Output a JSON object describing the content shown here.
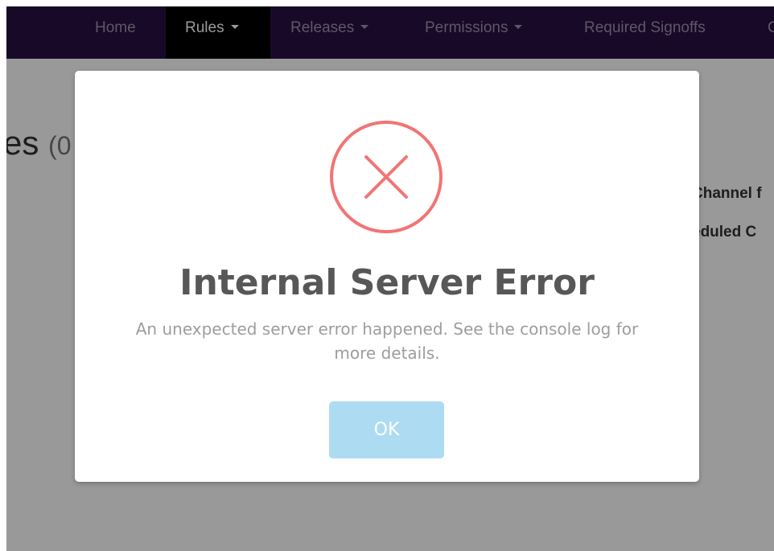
{
  "navbar": {
    "items": [
      {
        "label": "Home",
        "has_caret": false,
        "active": false
      },
      {
        "label": "Rules",
        "has_caret": true,
        "active": true
      },
      {
        "label": "Releases",
        "has_caret": true,
        "active": false
      },
      {
        "label": "Permissions",
        "has_caret": true,
        "active": false
      },
      {
        "label": "Required Signoffs",
        "has_caret": false,
        "active": false
      },
      {
        "label": "C",
        "has_caret": false,
        "active": false
      }
    ]
  },
  "page": {
    "heading_partial": "es",
    "count_partial": "(0",
    "side_labels": [
      "Channel f",
      "eduled C"
    ]
  },
  "modal": {
    "icon": "error-x-circle-icon",
    "title": "Internal Server Error",
    "text": "An unexpected server error happened. See the console log for more details.",
    "ok_label": "OK"
  },
  "colors": {
    "navbar_bg": "#2a0f43",
    "error_red": "#f27474",
    "ok_button_bg": "#addcf2"
  }
}
